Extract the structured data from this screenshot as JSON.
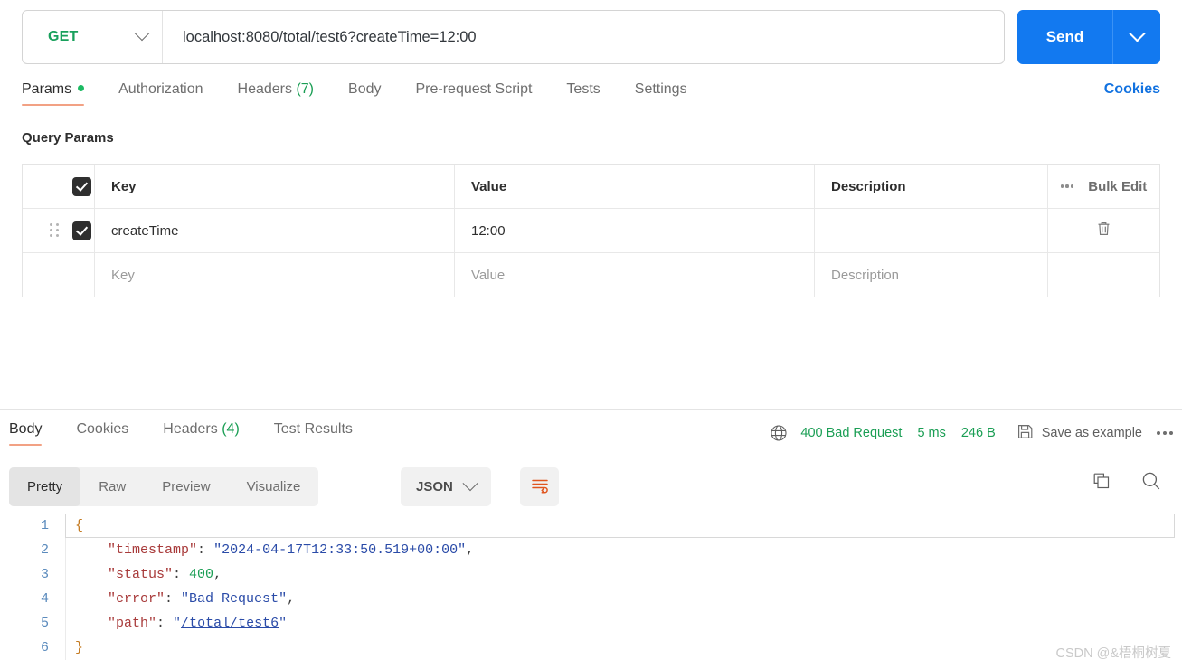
{
  "request": {
    "method": "GET",
    "url": "localhost:8080/total/test6?createTime=12:00",
    "send_label": "Send",
    "tabs": [
      {
        "label": "Params",
        "badge": "",
        "dot": true,
        "active": true
      },
      {
        "label": "Authorization",
        "badge": "",
        "dot": false,
        "active": false
      },
      {
        "label": "Headers",
        "badge": "(7)",
        "dot": false,
        "active": false
      },
      {
        "label": "Body",
        "badge": "",
        "dot": false,
        "active": false
      },
      {
        "label": "Pre-request Script",
        "badge": "",
        "dot": false,
        "active": false
      },
      {
        "label": "Tests",
        "badge": "",
        "dot": false,
        "active": false
      },
      {
        "label": "Settings",
        "badge": "",
        "dot": false,
        "active": false
      }
    ],
    "cookies_label": "Cookies"
  },
  "query_params": {
    "title": "Query Params",
    "columns": [
      "Key",
      "Value",
      "Description"
    ],
    "bulk_edit_label": "Bulk Edit",
    "rows": [
      {
        "checked": true,
        "key": "createTime",
        "value": "12:00",
        "description": ""
      }
    ],
    "placeholder_row": {
      "key": "Key",
      "value": "Value",
      "description": "Description"
    }
  },
  "response": {
    "tabs": [
      {
        "label": "Body",
        "badge": "",
        "active": true
      },
      {
        "label": "Cookies",
        "badge": "",
        "active": false
      },
      {
        "label": "Headers",
        "badge": "(4)",
        "active": false
      },
      {
        "label": "Test Results",
        "badge": "",
        "active": false
      }
    ],
    "status": "400 Bad Request",
    "time": "5 ms",
    "size": "246 B",
    "save_example_label": "Save as example",
    "status_color": "#1a9e54",
    "view_tabs": [
      {
        "label": "Pretty",
        "active": true
      },
      {
        "label": "Raw",
        "active": false
      },
      {
        "label": "Preview",
        "active": false
      },
      {
        "label": "Visualize",
        "active": false
      }
    ],
    "format": "JSON",
    "body_lines": [
      {
        "n": "1",
        "tokens": [
          {
            "t": "{",
            "c": "k-brace"
          }
        ]
      },
      {
        "n": "2",
        "tokens": [
          {
            "t": "    ",
            "c": "k-punc"
          },
          {
            "t": "\"timestamp\"",
            "c": "k-key"
          },
          {
            "t": ": ",
            "c": "k-punc"
          },
          {
            "t": "\"2024-04-17T12:33:50.519+00:00\"",
            "c": "k-str"
          },
          {
            "t": ",",
            "c": "k-punc"
          }
        ]
      },
      {
        "n": "3",
        "tokens": [
          {
            "t": "    ",
            "c": "k-punc"
          },
          {
            "t": "\"status\"",
            "c": "k-key"
          },
          {
            "t": ": ",
            "c": "k-punc"
          },
          {
            "t": "400",
            "c": "k-num"
          },
          {
            "t": ",",
            "c": "k-punc"
          }
        ]
      },
      {
        "n": "4",
        "tokens": [
          {
            "t": "    ",
            "c": "k-punc"
          },
          {
            "t": "\"error\"",
            "c": "k-key"
          },
          {
            "t": ": ",
            "c": "k-punc"
          },
          {
            "t": "\"Bad Request\"",
            "c": "k-str"
          },
          {
            "t": ",",
            "c": "k-punc"
          }
        ]
      },
      {
        "n": "5",
        "tokens": [
          {
            "t": "    ",
            "c": "k-punc"
          },
          {
            "t": "\"path\"",
            "c": "k-key"
          },
          {
            "t": ": ",
            "c": "k-punc"
          },
          {
            "t": "\"",
            "c": "k-str"
          },
          {
            "t": "/total/test6",
            "c": "k-link"
          },
          {
            "t": "\"",
            "c": "k-str"
          }
        ]
      },
      {
        "n": "6",
        "tokens": [
          {
            "t": "}",
            "c": "k-brace"
          }
        ]
      }
    ]
  },
  "watermark": "CSDN @&梧桐树夏"
}
